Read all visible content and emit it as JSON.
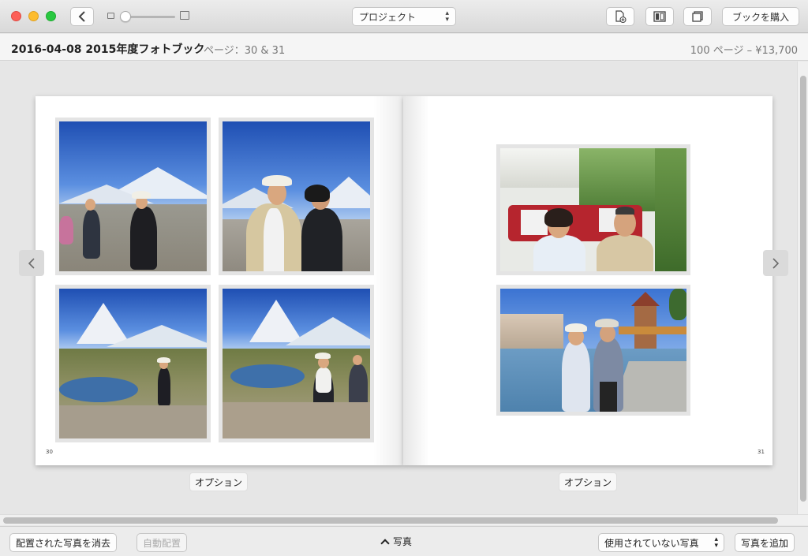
{
  "toolbar": {
    "project_label": "プロジェクト",
    "buy_label": "ブックを購入"
  },
  "header": {
    "book_title": "2016-04-08 2015年度フォトブック",
    "pages_label": "ページ：30 & 31",
    "price_label": "100 ページ – ¥13,700"
  },
  "spread": {
    "left_page_number": "30",
    "right_page_number": "31",
    "left_option_label": "オプション",
    "right_option_label": "オプション"
  },
  "bottom_bar": {
    "clear_button": "配置された写真を消去",
    "autoflow_button": "自動配置",
    "photos_toggle": "写真",
    "filter_select": "使用されていない写真",
    "add_photos_button": "写真を追加"
  },
  "colors": {
    "close": "#fc5f57",
    "minimize": "#fdbc2e",
    "zoom": "#29c840"
  }
}
